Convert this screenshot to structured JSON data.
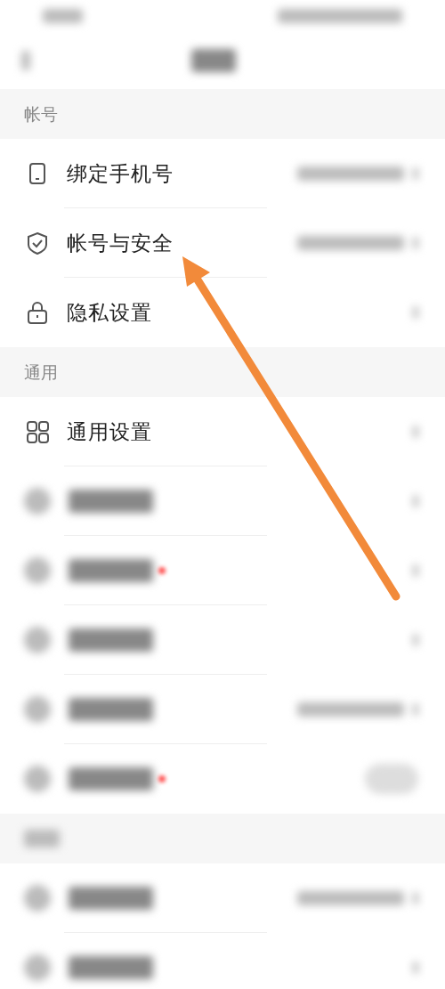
{
  "sections": [
    {
      "title": "帐号",
      "rows": [
        {
          "kind": "phone",
          "label": "绑定手机号",
          "blurred_value": true
        },
        {
          "kind": "shield",
          "label": "帐号与安全",
          "blurred_value": true
        },
        {
          "kind": "lock",
          "label": "隐私设置",
          "blurred_value": false
        }
      ]
    },
    {
      "title": "通用",
      "rows": [
        {
          "kind": "grid",
          "label": "通用设置",
          "blurred_value": false
        },
        {
          "kind": "blurred",
          "badge": false,
          "blurred_value": false
        },
        {
          "kind": "blurred",
          "badge": true,
          "blurred_value": false
        },
        {
          "kind": "blurred",
          "badge": false,
          "blurred_value": false
        },
        {
          "kind": "blurred",
          "badge": false,
          "blurred_value": true
        },
        {
          "kind": "blurred_toggle",
          "badge": true,
          "on": false
        }
      ]
    },
    {
      "rows": [
        {
          "kind": "blurred",
          "badge": false,
          "blurred_value": true
        },
        {
          "kind": "blurred",
          "badge": false,
          "blurred_value": false
        }
      ]
    }
  ],
  "annotation": {
    "kind": "arrow"
  }
}
